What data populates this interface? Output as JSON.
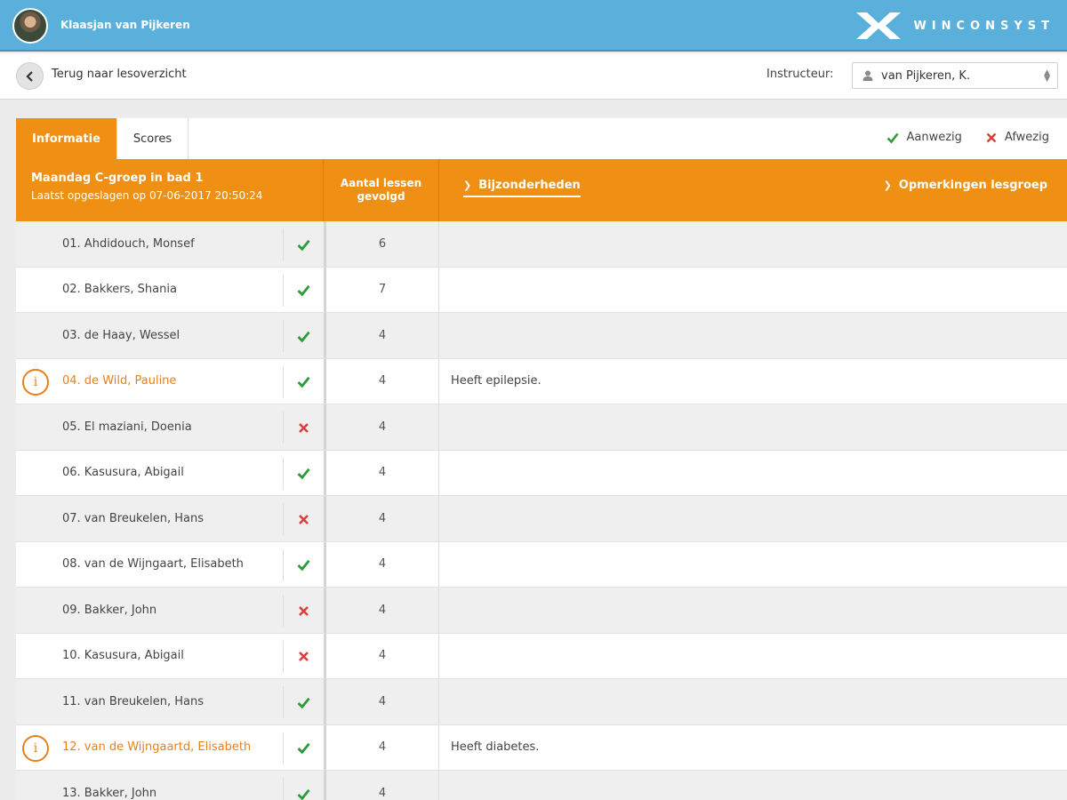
{
  "header": {
    "user_name": "Klaasjan van Pijkeren",
    "logo_text": "WINCONSYST",
    "brand_color": "#5ab0da"
  },
  "subbar": {
    "back_label": "Terug naar lesoverzicht",
    "instructor_label": "Instructeur:",
    "instructor_value": "van Pijkeren, K."
  },
  "tabs": [
    {
      "label": "Informatie",
      "active": true
    },
    {
      "label": "Scores",
      "active": false
    }
  ],
  "legend": {
    "present_label": "Aanwezig",
    "absent_label": "Afwezig",
    "present_color": "#2e9a3a",
    "absent_color": "#d9403a"
  },
  "table_header": {
    "group_title": "Maandag C-groep in bad 1",
    "saved_text": "Laatst opgeslagen op 07-06-2017 20:50:24",
    "count_line1": "Aantal lessen",
    "count_line2": "gevolgd",
    "bijzonderheden": "Bijzonderheden",
    "opmerkingen": "Opmerkingen lesgroep",
    "accent_color": "#ef8f14"
  },
  "students": [
    {
      "name": "01.  Ahdidouch, Monsef",
      "present": true,
      "count": "6",
      "note": "",
      "alert": false
    },
    {
      "name": "02.  Bakkers, Shania",
      "present": true,
      "count": "7",
      "note": "",
      "alert": false
    },
    {
      "name": "03.  de Haay, Wessel",
      "present": true,
      "count": "4",
      "note": "",
      "alert": false
    },
    {
      "name": "04.  de Wild, Pauline",
      "present": true,
      "count": "4",
      "note": "Heeft epilepsie.",
      "alert": true
    },
    {
      "name": "05.  El maziani, Doenia",
      "present": false,
      "count": "4",
      "note": "",
      "alert": false
    },
    {
      "name": "06.  Kasusura, Abigail",
      "present": true,
      "count": "4",
      "note": "",
      "alert": false
    },
    {
      "name": "07.  van Breukelen, Hans",
      "present": false,
      "count": "4",
      "note": "",
      "alert": false
    },
    {
      "name": "08.  van de Wijngaart, Elisabeth",
      "present": true,
      "count": "4",
      "note": "",
      "alert": false
    },
    {
      "name": "09.  Bakker, John",
      "present": false,
      "count": "4",
      "note": "",
      "alert": false
    },
    {
      "name": "10.  Kasusura, Abigail",
      "present": false,
      "count": "4",
      "note": "",
      "alert": false
    },
    {
      "name": "11.  van Breukelen, Hans",
      "present": true,
      "count": "4",
      "note": "",
      "alert": false
    },
    {
      "name": "12.  van de Wijngaartd, Elisabeth",
      "present": true,
      "count": "4",
      "note": "Heeft diabetes.",
      "alert": true
    },
    {
      "name": "13.  Bakker, John",
      "present": true,
      "count": "4",
      "note": "",
      "alert": false
    }
  ]
}
